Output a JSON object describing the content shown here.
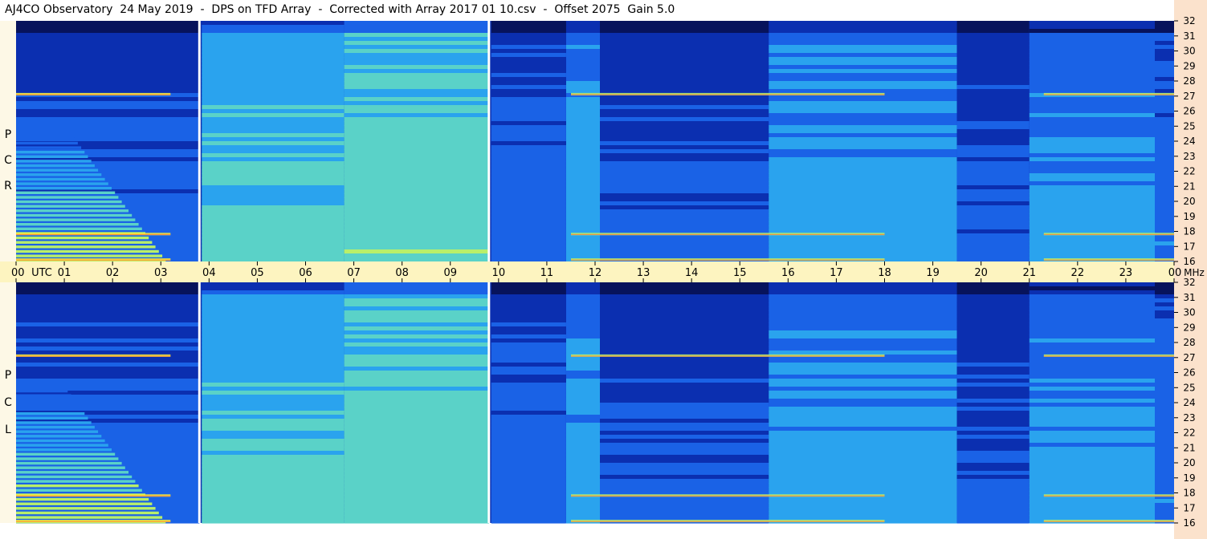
{
  "header": {
    "title": "AJ4CO Observatory  24 May 2019  -  DPS on TFD Array  -  Corrected with Array 2017 01 10.csv  -  Offset 2075  Gain 5.0"
  },
  "chart_data": {
    "type": "heatmap",
    "title": "AJ4CO Observatory  24 May 2019  -  DPS on TFD Array  -  Corrected with Array 2017 01 10.csv  -  Offset 2075  Gain 5.0",
    "x_axis": {
      "unit_label": "UTC",
      "ticks": [
        "00",
        "01",
        "02",
        "03",
        "04",
        "05",
        "06",
        "07",
        "08",
        "09",
        "10",
        "11",
        "12",
        "13",
        "14",
        "15",
        "16",
        "17",
        "18",
        "19",
        "20",
        "21",
        "22",
        "23",
        "00"
      ],
      "range_hours": [
        0,
        24
      ]
    },
    "y_axis": {
      "unit_label": "MHz",
      "ticks": [
        "32",
        "31",
        "30",
        "29",
        "28",
        "27",
        "26",
        "25",
        "24",
        "23",
        "22",
        "21",
        "20",
        "19",
        "18",
        "17",
        "16"
      ],
      "range_mhz": [
        16,
        32
      ]
    },
    "panels": [
      {
        "polarization": "RCP",
        "letters": [
          "P",
          "C",
          "R"
        ]
      },
      {
        "polarization": "LCP",
        "letters": [
          "P",
          "C",
          "L"
        ]
      }
    ],
    "data_gaps_utc": [
      3.8,
      9.8
    ],
    "segments": [
      {
        "start": 0.0,
        "end": 3.8,
        "level": 0.32
      },
      {
        "start": 3.85,
        "end": 6.8,
        "level": 0.55
      },
      {
        "start": 6.8,
        "end": 9.8,
        "level": 0.6
      },
      {
        "start": 9.85,
        "end": 11.4,
        "level": 0.34
      },
      {
        "start": 11.4,
        "end": 12.1,
        "level": 0.46
      },
      {
        "start": 12.1,
        "end": 15.6,
        "level": 0.3
      },
      {
        "start": 15.6,
        "end": 19.5,
        "level": 0.46
      },
      {
        "start": 19.5,
        "end": 21.0,
        "level": 0.3
      },
      {
        "start": 21.0,
        "end": 23.6,
        "level": 0.44
      },
      {
        "start": 23.6,
        "end": 24.0,
        "level": 0.36
      }
    ],
    "emission_bands_mhz": [
      27.1,
      17.8,
      16.1
    ],
    "intensity_scale": [
      "#07135c",
      "#0b2fb0",
      "#1a62e6",
      "#2aa3ee",
      "#5ad2c8",
      "#b8ef6a",
      "#f6ee3a",
      "#ff7a3a",
      "#e82a6a"
    ],
    "gap_color": "#ffffff",
    "axis_band_color": "#fdf4c0",
    "side_bar_color": "#fbe2cc"
  }
}
